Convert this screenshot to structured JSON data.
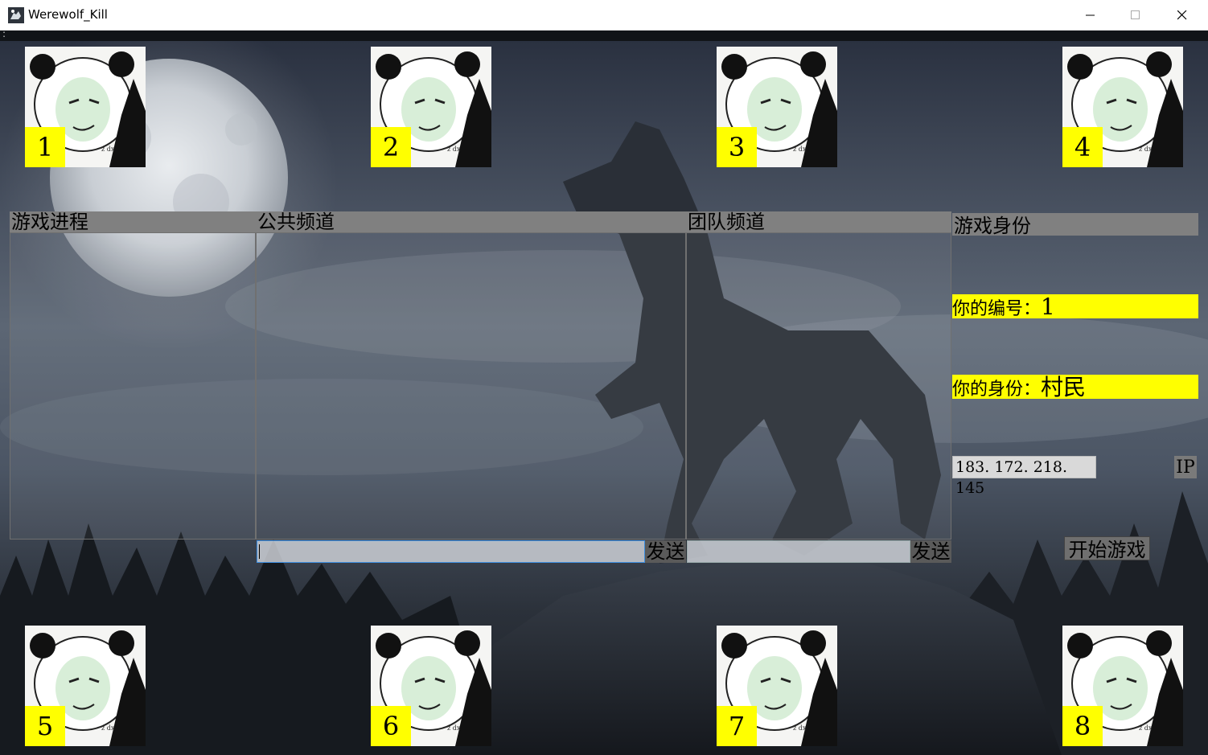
{
  "window": {
    "title": "Werewolf_Kill",
    "menu_glyph": ":"
  },
  "seats": [
    {
      "number": "1"
    },
    {
      "number": "2"
    },
    {
      "number": "3"
    },
    {
      "number": "4"
    },
    {
      "number": "5"
    },
    {
      "number": "6"
    },
    {
      "number": "7"
    },
    {
      "number": "8"
    }
  ],
  "panels": {
    "progress_title": "游戏进程",
    "public_title": "公共频道",
    "team_title": "团队频道",
    "identity_title": "游戏身份"
  },
  "public_chat": {
    "input_value": "",
    "send_label": "发送"
  },
  "team_chat": {
    "input_value": "",
    "send_label": "发送"
  },
  "identity": {
    "number_label": "你的编号：",
    "number_value": "1",
    "role_label": "你的身份：",
    "role_value": "村民"
  },
  "connection": {
    "ip_value": "183. 172. 218. 145",
    "ip_label": "IP"
  },
  "start_button": {
    "label": "开始游戏"
  },
  "colors": {
    "seat_number_bg": "#ffff00",
    "panel_header_bg": "#808080",
    "identity_row_bg": "#ffff00"
  },
  "icons": [
    "werewolf-app-icon",
    "minimize-icon",
    "maximize-icon",
    "close-icon",
    "panda-meme-avatar"
  ]
}
